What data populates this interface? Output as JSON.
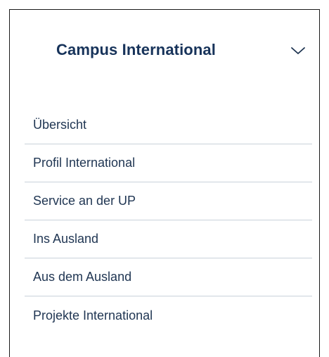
{
  "section": {
    "title": "Campus International",
    "toggle_icon": "chevron-down-icon"
  },
  "menu": {
    "items": [
      {
        "label": "Übersicht"
      },
      {
        "label": "Profil International"
      },
      {
        "label": "Service an der UP"
      },
      {
        "label": "Ins Ausland"
      },
      {
        "label": "Aus dem Ausland"
      },
      {
        "label": "Projekte International"
      }
    ]
  },
  "colors": {
    "title": "#17335a",
    "text": "#1f3552",
    "divider": "#c9d1da",
    "border": "#1a1a1a"
  }
}
